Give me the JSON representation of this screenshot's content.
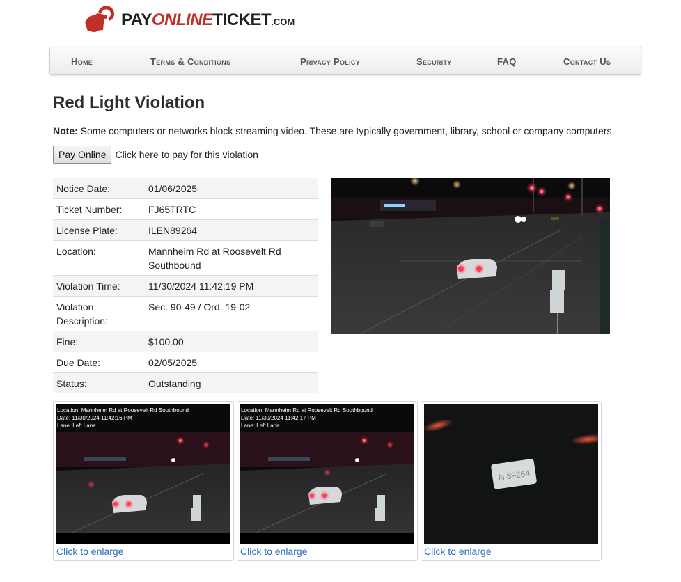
{
  "logo": {
    "part1": "PAY",
    "part2": "ONLINE",
    "part3": "TICKET",
    "part4": ".COM",
    "brand_color": "#c0302b"
  },
  "nav": {
    "items": [
      {
        "label": "Home"
      },
      {
        "label": "Terms & Conditions"
      },
      {
        "label": "Privacy Policy"
      },
      {
        "label": "Security"
      },
      {
        "label": "FAQ"
      },
      {
        "label": "Contact Us"
      }
    ]
  },
  "page": {
    "title": "Red Light Violation",
    "note_label": "Note:",
    "note_text": " Some computers or networks block streaming video. These are typically government, library, school or company computers.",
    "pay_button": "Pay Online",
    "pay_text": "Click here to pay for this violation"
  },
  "details": [
    {
      "key": "Notice Date:",
      "value": "01/06/2025"
    },
    {
      "key": "Ticket Number:",
      "value": "FJ65TRTC"
    },
    {
      "key": "License Plate:",
      "value": "ILEN89264"
    },
    {
      "key": "Location:",
      "value": "Mannheim Rd at Roosevelt Rd Southbound"
    },
    {
      "key": "Violation Time:",
      "value": "11/30/2024 11:42:19 PM"
    },
    {
      "key": "Violation Description:",
      "value": "Sec. 90-49 / Ord. 19-02"
    },
    {
      "key": "Fine:",
      "value": "$100.00"
    },
    {
      "key": "Due Date:",
      "value": "02/05/2025"
    },
    {
      "key": "Status:",
      "value": "Outstanding"
    }
  ],
  "thumbnails": [
    {
      "location": "Location:  Mannheim Rd at Roosevelt Rd Southbound",
      "date": "Date:  11/30/2024 11:42:16 PM",
      "lane": "Lane:  Left Lane",
      "link": "Click to enlarge"
    },
    {
      "location": "Location:  Mannheim Rd at Roosevelt Rd Southbound",
      "date": "Date:  11/30/2024 11:42:17 PM",
      "lane": "Lane:  Left Lane",
      "link": "Click to enlarge"
    },
    {
      "plate_text": "N 89264",
      "link": "Click to enlarge"
    }
  ]
}
